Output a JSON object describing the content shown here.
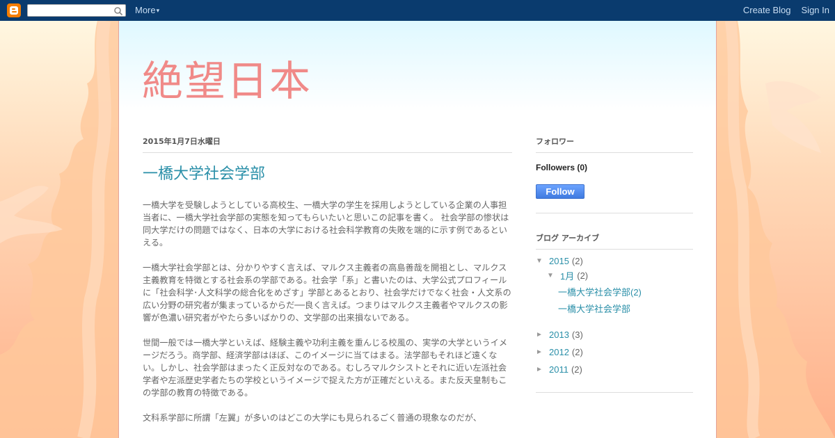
{
  "navbar": {
    "search_placeholder": "",
    "more_label": "More",
    "create_blog_label": "Create Blog",
    "sign_in_label": "Sign In"
  },
  "header": {
    "blog_title": "絶望日本"
  },
  "post": {
    "date": "2015年1月7日水曜日",
    "title": "一橋大学社会学部",
    "paragraphs": [
      "一橋大学を受験しようとしている高校生、一橋大学の学生を採用しようとしている企業の人事担当者に、一橋大学社会学部の実態を知ってもらいたいと思いこの記事を書く。 社会学部の惨状は同大学だけの問題ではなく、日本の大学における社会科学教育の失敗を端的に示す例であるといえる。",
      "一橋大学社会学部とは、分かりやすく言えば、マルクス主義者の高島善哉を開祖とし、マルクス主義教育を特徴とする社会系の学部である。社会学「系」と書いたのは、大学公式プロフィールに「社会科学･人文科学の総合化をめざす」学部とあるとおり、社会学だけでなく社会・人文系の広い分野の研究者が集まっているからだ──良く言えば。つまりはマルクス主義者やマルクスの影響が色濃い研究者がやたら多いばかりの、文学部の出来損ないである。",
      "世間一般では一橋大学といえば、経験主義や功利主義を重んじる校風の、実学の大学というイメージだろう。商学部、経済学部はほぼ、このイメージに当てはまる。法学部もそれほど遠くない。しかし、社会学部はまったく正反対なのである。むしろマルクシストとそれに近い左派社会学者や左派歴史学者たちの学校というイメージで捉えた方が正確だといえる。また反天皇制もこの学部の教育の特徴である。",
      "文科系学部に所謂「左翼」が多いのはどこの大学にも見られるごく普通の現象なのだが、"
    ]
  },
  "sidebar": {
    "followers": {
      "title": "フォロワー",
      "count_label": "Followers (0)",
      "follow_label": "Follow"
    },
    "archive": {
      "title": "ブログ アーカイブ",
      "expanded_toggle": "▼",
      "collapsed_toggle": "►",
      "years": [
        {
          "year": "2015",
          "count": "(2)",
          "expanded": true,
          "months": [
            {
              "month": "1月",
              "count": "(2)",
              "posts": [
                "一橋大学社会学部(2)",
                "一橋大学社会学部"
              ]
            }
          ]
        },
        {
          "year": "2013",
          "count": "(3)",
          "expanded": false
        },
        {
          "year": "2012",
          "count": "(2)",
          "expanded": false
        },
        {
          "year": "2011",
          "count": "(2)",
          "expanded": false
        }
      ]
    }
  },
  "colors": {
    "navbar_bg": "#0a3b6e",
    "title_color": "#f08a88",
    "link_color": "#2a8fa8",
    "follow_button": "#4a85ea"
  }
}
